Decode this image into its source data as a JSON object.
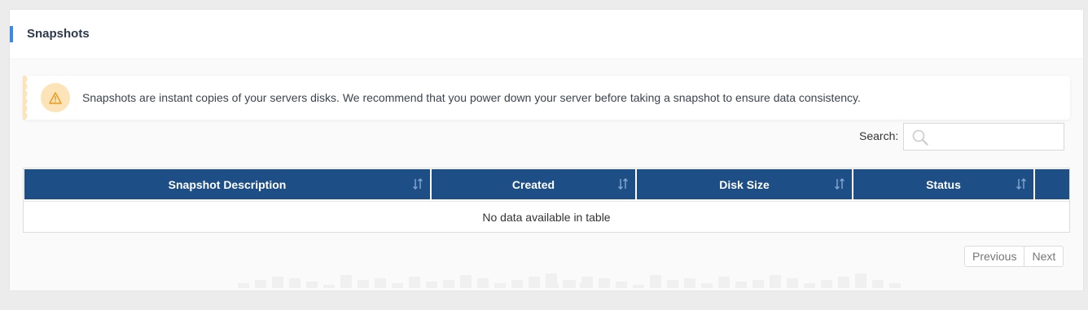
{
  "panel": {
    "title": "Snapshots"
  },
  "alert": {
    "text": "Snapshots are instant copies of your servers disks. We recommend that you power down your server before taking a snapshot to ensure data consistency.",
    "icon": "warning-icon",
    "icon_color": "#e59a1a",
    "icon_bg": "#fde3b8"
  },
  "search": {
    "label": "Search:",
    "value": "",
    "placeholder": ""
  },
  "table": {
    "header_color": "#1d4e85",
    "columns": [
      {
        "label": "Snapshot Description",
        "sortable": true
      },
      {
        "label": "Created",
        "sortable": true
      },
      {
        "label": "Disk Size",
        "sortable": true
      },
      {
        "label": "Status",
        "sortable": true
      },
      {
        "label": "",
        "sortable": false
      }
    ],
    "empty_message": "No data available in table"
  },
  "pagination": {
    "previous": "Previous",
    "next": "Next"
  },
  "colors": {
    "accent": "#3f87e5",
    "page_bg": "#ececec"
  }
}
